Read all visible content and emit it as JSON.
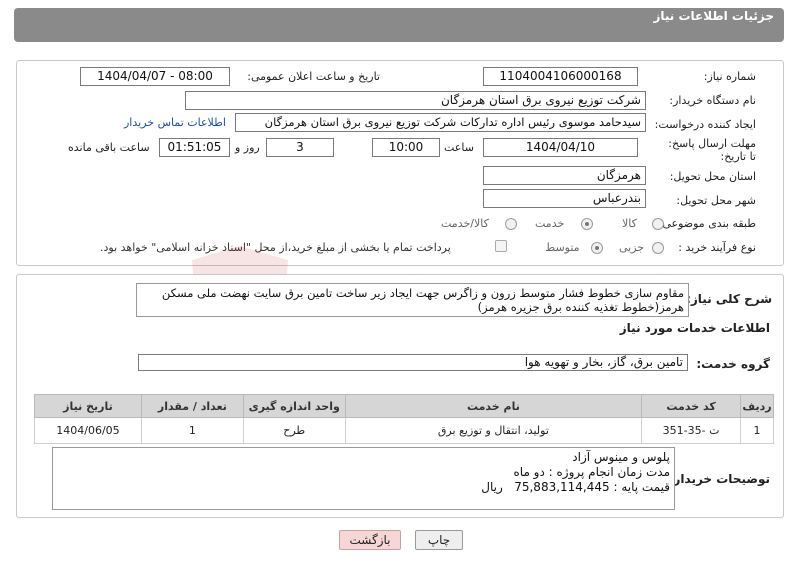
{
  "header": {
    "title": "جزئیات اطلاعات نیاز"
  },
  "labels": {
    "need_number": "شماره نیاز:",
    "announce_datetime": "تاریخ و ساعت اعلان عمومی:",
    "buyer_org": "نام دستگاه خریدار:",
    "requester": "ایجاد کننده درخواست:",
    "deadline": "مهلت ارسال پاسخ: تا تاریخ:",
    "time_word": "ساعت",
    "days_and": "روز و",
    "remaining": "ساعت باقی مانده",
    "province": "استان محل تحویل:",
    "city": "شهر محل تحویل:",
    "category": "طبقه بندی موضوعی:",
    "process_type": "نوع فرآیند خرید :",
    "general_desc": "شرح کلی نیاز:",
    "services_info": "اطلاعات خدمات مورد نیاز",
    "service_group": "گروه خدمت:",
    "buyer_notes": "توضیحات خریدار:"
  },
  "fields": {
    "need_number": "1104004106000168",
    "announce_datetime": "1404/04/07 - 08:00",
    "buyer_org": "شرکت توزیع نیروی برق استان هرمزگان",
    "requester": "سیدحامد موسوی رئیس اداره تدارکات شرکت توزیع نیروی برق استان هرمزگان",
    "contact_link": "اطلاعات تماس خریدار",
    "deadline_date": "1404/04/10",
    "deadline_time": "10:00",
    "days": "3",
    "remaining_time": "01:51:05",
    "province": "هرمزگان",
    "city": "بندرعباس",
    "general_desc": "مقاوم سازی خطوط فشار متوسط زرون و زاگرس  جهت ایجاد زیر ساخت تامین برق سایت نهضت ملی مسکن هرمز(خطوط تغذیه کننده برق جزیره هرمز)",
    "service_group": "تامین برق، گاز، بخار و تهویه هوا"
  },
  "category_options": [
    {
      "label": "کالا",
      "selected": false
    },
    {
      "label": "خدمت",
      "selected": true
    },
    {
      "label": "کالا/خدمت",
      "selected": false
    }
  ],
  "process_options": [
    {
      "label": "جزیی",
      "selected": false
    },
    {
      "label": "متوسط",
      "selected": true
    }
  ],
  "payment_note": "پرداخت تمام یا بخشی از مبلغ خرید،از محل \"اسناد خزانه اسلامی\" خواهد بود.",
  "table": {
    "headers": [
      "ردیف",
      "کد خدمت",
      "نام خدمت",
      "واحد اندازه گیری",
      "تعداد / مقدار",
      "تاریخ نیاز"
    ],
    "rows": [
      [
        "1",
        "ت -35-351",
        "تولید، انتقال و توزیع برق",
        "طرح",
        "1",
        "1404/06/05"
      ]
    ]
  },
  "buyer_notes": [
    "پلوس و مینوس آزاد",
    "مدت زمان انجام پروژه : دو ماه",
    "قیمت پایه : 75,883,114,445   ریال"
  ],
  "buttons": {
    "print": "چاپ",
    "back": "بازگشت"
  },
  "watermark": "AriaTender.neT",
  "colors": {
    "header": "#8a8a8a",
    "back_button": "#f6d6d6",
    "print_button": "#eeeeee",
    "link": "#1a4fb5"
  }
}
